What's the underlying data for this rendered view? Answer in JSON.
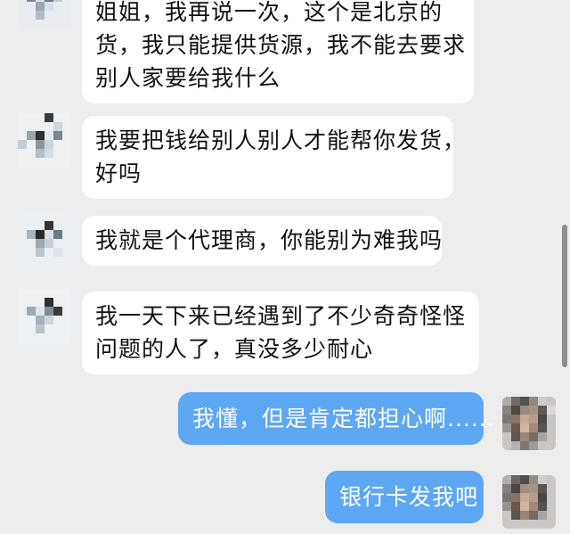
{
  "conversation": {
    "messages": [
      {
        "side": "received",
        "lines": [
          "姐姐，我再说一次，这个是北京的",
          "货，我只能提供货源，我不能去要求",
          "别人家要给我什么"
        ]
      },
      {
        "side": "received",
        "lines": [
          "我要把钱给别人别人才能帮你发货，",
          "好吗"
        ]
      },
      {
        "side": "received",
        "lines": [
          "我就是个代理商，你能别为难我吗"
        ]
      },
      {
        "side": "received",
        "lines": [
          "我一天下来已经遇到了不少奇奇怪怪",
          "问题的人了，真没多少耐心"
        ]
      },
      {
        "side": "sent",
        "lines": [
          "我懂，但是肯定都担心啊......"
        ]
      },
      {
        "side": "sent",
        "lines": [
          "银行卡发我吧"
        ]
      }
    ]
  },
  "colors": {
    "background": "#ededed",
    "received_bubble": "#ffffff",
    "sent_bubble": "#5ea7f3",
    "sent_text": "#ffffff",
    "received_text": "#111111"
  },
  "icons": {
    "contact_avatar": "pixelated-avatar-icon",
    "self_avatar": "pixelated-avatar-icon"
  }
}
